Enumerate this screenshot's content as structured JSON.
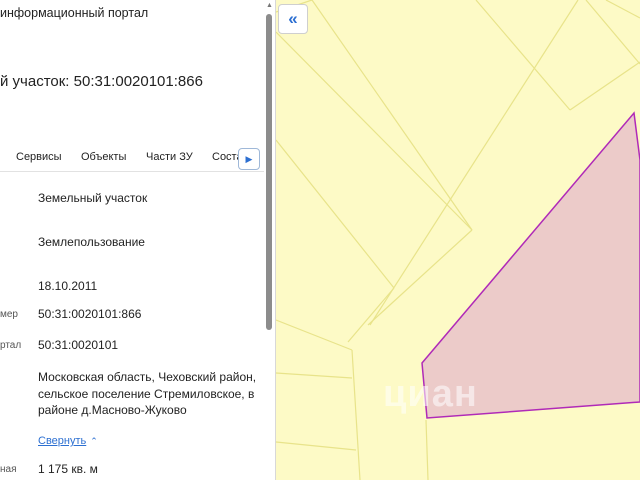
{
  "header": {
    "portal_title": "информационный портал",
    "parcel_title": "й участок: 50:31:0020101:866"
  },
  "tabs": [
    {
      "label": "Сервисы"
    },
    {
      "label": "Объекты"
    },
    {
      "label": "Части ЗУ"
    },
    {
      "label": "Соста"
    }
  ],
  "tab_scroll_icon": "chevron-right-icon",
  "details": {
    "type_value": "Земельный участок",
    "category_value": "Землепользование",
    "date_value": "18.10.2011",
    "number_label": "мер",
    "number_value": "50:31:0020101:866",
    "quarter_label": "ртал",
    "quarter_value": "50:31:0020101",
    "address_value": "Московская область, Чеховский район, сельское поселение Стремиловское, в районе д.Масново-Жуково",
    "collapse_label": "Свернуть",
    "area_label": "ная",
    "area_value": "1 175 кв. м"
  },
  "map": {
    "collapse_icon": "double-chevron-left-icon",
    "watermark": "циан",
    "colors": {
      "background": "#fdfac6",
      "parcel_lines": "#e8e38a",
      "selected_fill": "#eccbc9",
      "selected_stroke": "#b02ab8",
      "accent": "#2c6fd1"
    }
  }
}
